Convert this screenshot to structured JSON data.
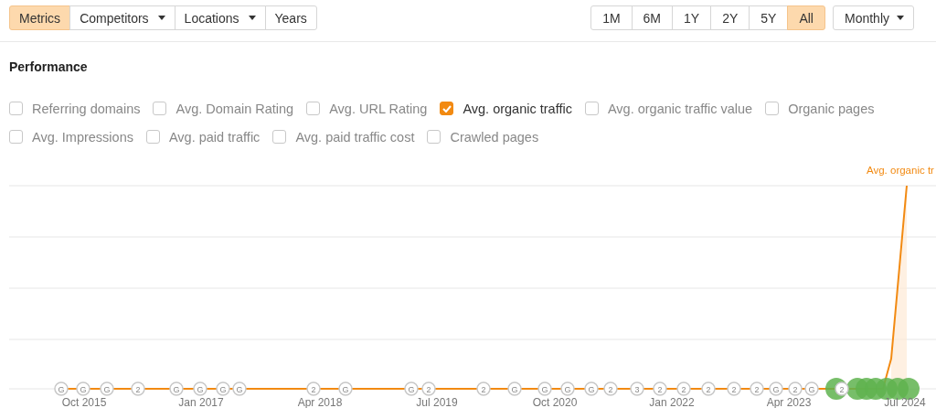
{
  "toolbar": {
    "views": [
      {
        "label": "Metrics",
        "selected": true,
        "dropdown": false
      },
      {
        "label": "Competitors",
        "selected": false,
        "dropdown": true
      },
      {
        "label": "Locations",
        "selected": false,
        "dropdown": true
      },
      {
        "label": "Years",
        "selected": false,
        "dropdown": false
      }
    ],
    "ranges": [
      {
        "label": "1M",
        "selected": false
      },
      {
        "label": "6M",
        "selected": false
      },
      {
        "label": "1Y",
        "selected": false
      },
      {
        "label": "2Y",
        "selected": false
      },
      {
        "label": "5Y",
        "selected": false
      },
      {
        "label": "All",
        "selected": true
      }
    ],
    "interval": {
      "value": "Monthly"
    }
  },
  "section_title": "Performance",
  "metrics": [
    [
      {
        "label": "Referring domains",
        "checked": false
      },
      {
        "label": "Avg. Domain Rating",
        "checked": false
      },
      {
        "label": "Avg. URL Rating",
        "checked": false
      },
      {
        "label": "Avg. organic traffic",
        "checked": true
      },
      {
        "label": "Avg. organic traffic value",
        "checked": false
      },
      {
        "label": "Organic pages",
        "checked": false
      }
    ],
    [
      {
        "label": "Avg. Impressions",
        "checked": false
      },
      {
        "label": "Avg. paid traffic",
        "checked": false
      },
      {
        "label": "Avg. paid traffic cost",
        "checked": false
      },
      {
        "label": "Crawled pages",
        "checked": false
      }
    ]
  ],
  "chart": {
    "series_label": "Avg. organic tr",
    "x_labels": [
      "Oct 2015",
      "Jan 2017",
      "Apr 2018",
      "Jul 2019",
      "Oct 2020",
      "Jan 2022",
      "Apr 2023",
      "Jul 2024"
    ],
    "markers": [
      {
        "label": "G"
      },
      {
        "label": "G"
      },
      {
        "label": "G"
      },
      {
        "label": "2"
      },
      {
        "label": "G"
      },
      {
        "label": "G"
      },
      {
        "label": "G"
      },
      {
        "label": "G"
      },
      {
        "label": "2"
      },
      {
        "label": "G"
      },
      {
        "label": "G"
      },
      {
        "label": "2"
      },
      {
        "label": "2"
      },
      {
        "label": "G"
      },
      {
        "label": "G"
      },
      {
        "label": "G"
      },
      {
        "label": "G"
      },
      {
        "label": "2"
      },
      {
        "label": "3"
      },
      {
        "label": "2"
      },
      {
        "label": "2"
      },
      {
        "label": "2"
      },
      {
        "label": "2"
      },
      {
        "label": "2"
      },
      {
        "label": "G"
      },
      {
        "label": "2"
      },
      {
        "label": "G"
      },
      {
        "label": "2"
      }
    ]
  }
}
